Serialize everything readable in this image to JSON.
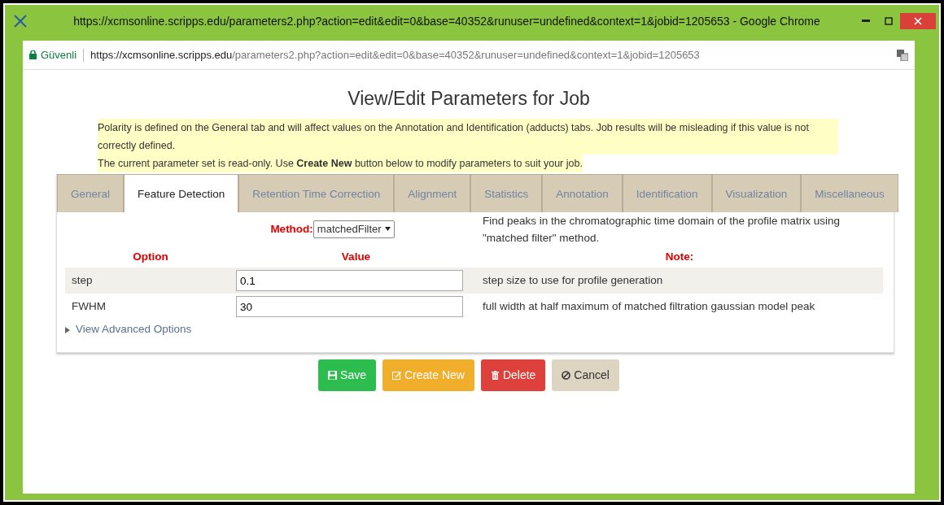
{
  "window": {
    "title": "https://xcmsonline.scripps.edu/parameters2.php?action=edit&edit=0&base=40352&runuser=undefined&context=1&jobid=1205653 - Google Chrome"
  },
  "address_bar": {
    "secure_label": "Güvenli",
    "url_host": "https://xcmsonline.scripps.edu",
    "url_path": "/parameters2.php?action=edit&edit=0&base=40352&runuser=undefined&context=1&jobid=1205653"
  },
  "heading": "View/Edit Parameters for Job",
  "notices": [
    "Polarity is defined on the General tab and will affect values on the Annotation and Identification (adducts) tabs. Job results will be misleading if this value is not correctly defined.",
    "The current parameter set is read-only. Use **Create New** button below to modify parameters to suit your job."
  ],
  "tabs": [
    {
      "label": "General",
      "selected": false
    },
    {
      "label": "Feature Detection",
      "selected": true
    },
    {
      "label": "Retention Time Correction",
      "selected": false
    },
    {
      "label": "Alignment",
      "selected": false
    },
    {
      "label": "Statistics",
      "selected": false
    },
    {
      "label": "Annotation",
      "selected": false
    },
    {
      "label": "Identification",
      "selected": false
    },
    {
      "label": "Visualization",
      "selected": false
    },
    {
      "label": "Miscellaneous",
      "selected": false
    }
  ],
  "method": {
    "label": "Method:",
    "value": "matchedFilter",
    "description": "Find peaks in the chromatographic time domain of the profile matrix using \"matched filter\" method."
  },
  "table": {
    "columns": [
      "Option",
      "Value",
      "Note:"
    ],
    "rows": [
      {
        "option": "step",
        "value": "0.1",
        "note": "step size to use for profile generation"
      },
      {
        "option": "FWHM",
        "value": "30",
        "note": "full width at half maximum of matched filtration gaussian model peak"
      }
    ]
  },
  "advanced_toggle": {
    "label": "View Advanced Options",
    "expanded": false
  },
  "buttons": [
    {
      "label": "Save",
      "kind": "save"
    },
    {
      "label": "Create New",
      "kind": "create"
    },
    {
      "label": "Delete",
      "kind": "delete"
    },
    {
      "label": "Cancel",
      "kind": "cancel"
    }
  ]
}
